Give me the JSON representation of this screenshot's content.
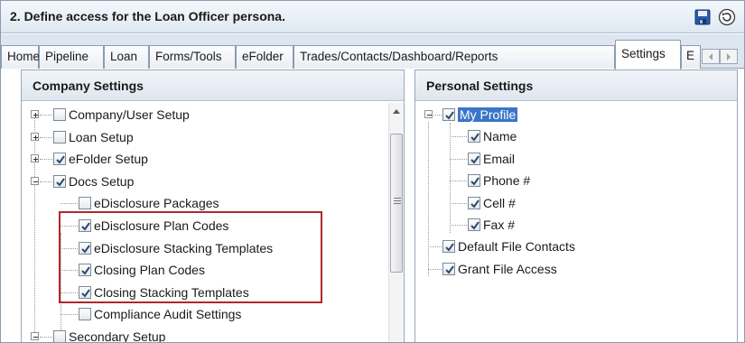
{
  "window": {
    "title": "2. Define access for the Loan Officer persona.",
    "save_icon": "save-icon",
    "refresh_icon": "refresh-icon"
  },
  "tabs": [
    {
      "label": "Home"
    },
    {
      "label": "Pipeline"
    },
    {
      "label": "Loan"
    },
    {
      "label": "Forms/Tools"
    },
    {
      "label": "eFolder"
    },
    {
      "label": "Trades/Contacts/Dashboard/Reports"
    },
    {
      "label": "Settings",
      "active": true
    },
    {
      "label": "E"
    }
  ],
  "company": {
    "header": "Company Settings",
    "items": [
      {
        "label": "Company/User Setup",
        "checked": false,
        "expander": "+"
      },
      {
        "label": "Loan Setup",
        "checked": false,
        "expander": "+"
      },
      {
        "label": "eFolder Setup",
        "checked": true,
        "expander": "+"
      },
      {
        "label": "Docs Setup",
        "checked": true,
        "expander": "-"
      },
      {
        "label": "eDisclosure Packages",
        "checked": false
      },
      {
        "label": "eDisclosure Plan Codes",
        "checked": true
      },
      {
        "label": "eDisclosure Stacking Templates",
        "checked": true
      },
      {
        "label": "Closing Plan Codes",
        "checked": true
      },
      {
        "label": "Closing Stacking Templates",
        "checked": true
      },
      {
        "label": "Compliance Audit Settings",
        "checked": false
      },
      {
        "label": "Secondary Setup",
        "checked": false,
        "expander": "-"
      }
    ]
  },
  "personal": {
    "header": "Personal Settings",
    "items": [
      {
        "label": "My Profile",
        "checked": true,
        "expander": "-",
        "selected": true
      },
      {
        "label": "Name",
        "checked": true
      },
      {
        "label": "Email",
        "checked": true
      },
      {
        "label": "Phone #",
        "checked": true
      },
      {
        "label": "Cell #",
        "checked": true
      },
      {
        "label": "Fax #",
        "checked": true
      },
      {
        "label": "Default File Contacts",
        "checked": true
      },
      {
        "label": "Grant File Access",
        "checked": true
      }
    ]
  },
  "colors": {
    "highlight_box": "#b1262b",
    "selection": "#3b75c9"
  }
}
